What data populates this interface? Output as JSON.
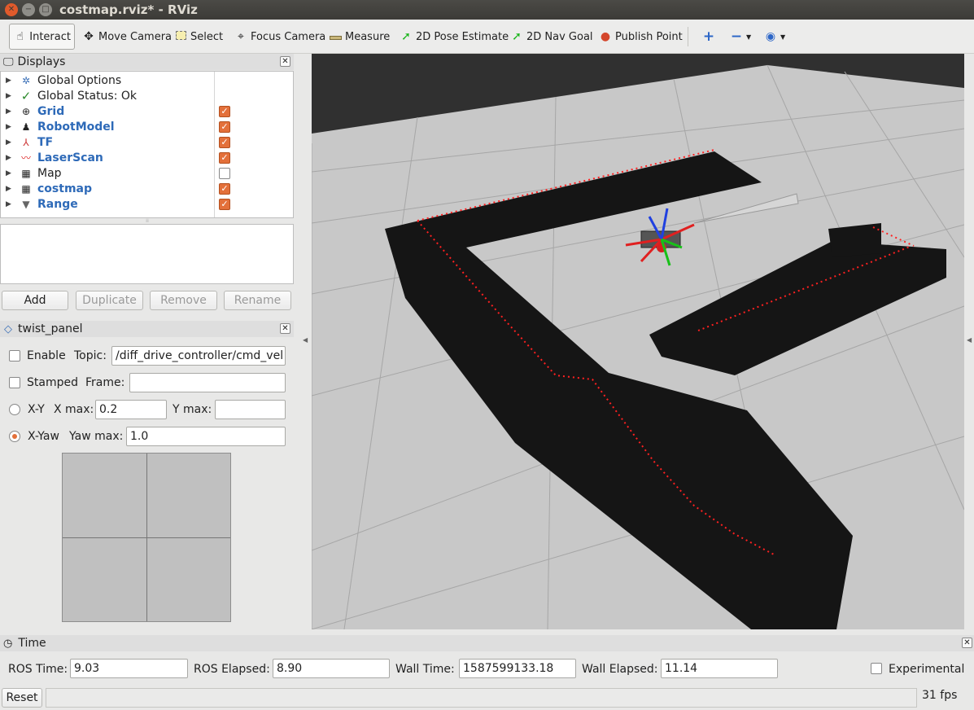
{
  "window": {
    "title": "costmap.rviz* - RViz"
  },
  "toolbar": {
    "tools": [
      {
        "label": "Interact",
        "icon": "hand-pointer-icon",
        "active": true
      },
      {
        "label": "Move Camera",
        "icon": "move-camera-icon"
      },
      {
        "label": "Select",
        "icon": "select-box-icon"
      },
      {
        "label": "Focus Camera",
        "icon": "crosshair-icon"
      },
      {
        "label": "Measure",
        "icon": "ruler-icon"
      },
      {
        "label": "2D Pose Estimate",
        "icon": "green-arrow-icon"
      },
      {
        "label": "2D Nav Goal",
        "icon": "green-arrow-icon"
      },
      {
        "label": "Publish Point",
        "icon": "map-pin-icon"
      }
    ]
  },
  "displays": {
    "title": "Displays",
    "items": [
      {
        "label": "Global Options",
        "icon": "gear-icon",
        "style": "normal",
        "checked": null
      },
      {
        "label": "Global Status: Ok",
        "icon": "check-icon",
        "style": "normal",
        "checked": null
      },
      {
        "label": "Grid",
        "icon": "grid-icon",
        "style": "blue",
        "checked": true
      },
      {
        "label": "RobotModel",
        "icon": "robot-icon",
        "style": "blue",
        "checked": true
      },
      {
        "label": "TF",
        "icon": "axes-icon",
        "style": "blue",
        "checked": true
      },
      {
        "label": "LaserScan",
        "icon": "laser-icon",
        "style": "blue",
        "checked": true
      },
      {
        "label": "Map",
        "icon": "map-icon",
        "style": "normal",
        "checked": false
      },
      {
        "label": "costmap",
        "icon": "map-icon",
        "style": "blue",
        "checked": true
      },
      {
        "label": "Range",
        "icon": "cone-icon",
        "style": "blue",
        "checked": true
      }
    ],
    "buttons": {
      "add": "Add",
      "duplicate": "Duplicate",
      "remove": "Remove",
      "rename": "Rename"
    }
  },
  "twist_panel": {
    "title": "twist_panel",
    "enable_label": "Enable",
    "topic_label": "Topic:",
    "topic_value": "/diff_drive_controller/cmd_vel",
    "stamped_label": "Stamped",
    "frame_label": "Frame:",
    "frame_value": "",
    "xy_label": "X-Y",
    "xmax_label": "X max:",
    "xmax_value": "0.2",
    "ymax_label": "Y max:",
    "ymax_value": "",
    "xyaw_label": "X-Yaw",
    "yawmax_label": "Yaw max:",
    "yawmax_value": "1.0"
  },
  "time": {
    "title": "Time",
    "ros_time_label": "ROS Time:",
    "ros_time": "9.03",
    "ros_elapsed_label": "ROS Elapsed:",
    "ros_elapsed": "8.90",
    "wall_time_label": "Wall Time:",
    "wall_time": "1587599133.18",
    "wall_elapsed_label": "Wall Elapsed:",
    "wall_elapsed": "11.14",
    "experimental_label": "Experimental"
  },
  "status": {
    "reset_label": "Reset",
    "fps": "31 fps"
  },
  "colors": {
    "accent": "#e3703a",
    "link_blue": "#2e6ab8",
    "laser_red": "#ff2020",
    "costmap_black": "#141414",
    "floor_gray": "#c9c9c9"
  }
}
